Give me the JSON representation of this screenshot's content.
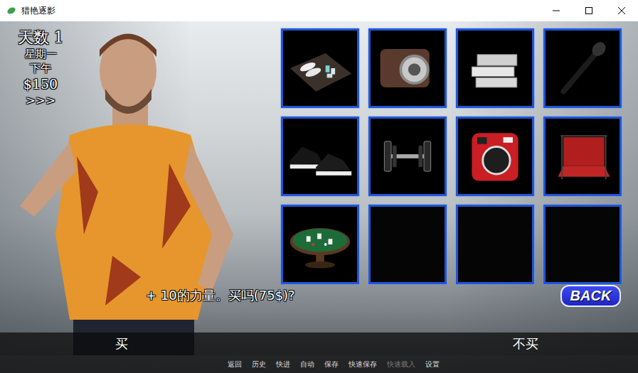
{
  "window": {
    "title": "猎艳逐影"
  },
  "stats": {
    "day_label": "天数",
    "day": "1",
    "weekday": "星期一",
    "time": "下午",
    "money": "$150",
    "skip": ">>>"
  },
  "shop": {
    "items": [
      {
        "kind": "towels"
      },
      {
        "kind": "camera"
      },
      {
        "kind": "books"
      },
      {
        "kind": "microphone"
      },
      {
        "kind": "sneakers"
      },
      {
        "kind": "dumbbell"
      },
      {
        "kind": "instant-camera"
      },
      {
        "kind": "backdrop"
      },
      {
        "kind": "poker-table"
      },
      {
        "kind": "empty"
      },
      {
        "kind": "empty"
      },
      {
        "kind": "empty"
      }
    ]
  },
  "dialogue": {
    "text": "+ 10的力量。买吗(75$)?"
  },
  "back_button": "BACK",
  "choices": [
    {
      "label": "买"
    },
    {
      "label": "不买"
    }
  ],
  "quick_menu": [
    {
      "label": "返回",
      "disabled": false
    },
    {
      "label": "历史",
      "disabled": false
    },
    {
      "label": "快进",
      "disabled": false
    },
    {
      "label": "自动",
      "disabled": false
    },
    {
      "label": "保存",
      "disabled": false
    },
    {
      "label": "快速保存",
      "disabled": false
    },
    {
      "label": "快速载入",
      "disabled": true
    },
    {
      "label": "设置",
      "disabled": false
    }
  ]
}
